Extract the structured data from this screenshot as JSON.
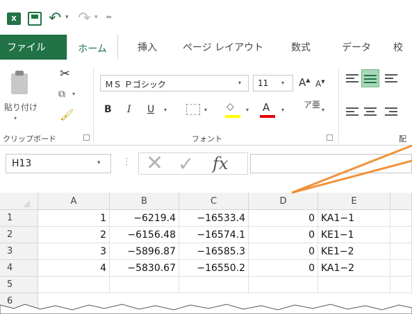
{
  "qat": {
    "excel_logo": "X",
    "undo_drop": "▾",
    "redo_drop": "▾",
    "more": "="
  },
  "tabs": {
    "file": "ファイル",
    "home": "ホーム",
    "insert": "挿入",
    "page_layout": "ページ レイアウト",
    "formulas": "数式",
    "data": "データ",
    "review": "校"
  },
  "ribbon": {
    "clipboard": {
      "paste_label": "貼り付け",
      "group_label": "クリップボード"
    },
    "font": {
      "font_name": "ＭＳ Ｐゴシック",
      "font_size": "11",
      "bold": "B",
      "italic": "I",
      "underline": "U",
      "fill_glyph": "◇",
      "font_color_glyph": "A",
      "phonetic_glyph": "ア亜",
      "group_label": "フォント"
    },
    "alignment": {
      "group_label": "配"
    }
  },
  "formula_bar": {
    "name_box": "H13",
    "dots": "⋮",
    "cancel": "✕",
    "enter": "✓",
    "fx": "fx",
    "formula": ""
  },
  "grid": {
    "columns": [
      "A",
      "B",
      "C",
      "D",
      "E"
    ],
    "rows": [
      "1",
      "2",
      "3",
      "4",
      "5",
      "6"
    ],
    "cells": [
      [
        "1",
        "−6219.4",
        "−16533.4",
        "0",
        "KA1−1"
      ],
      [
        "2",
        "−6156.48",
        "−16574.1",
        "0",
        "KE1−1"
      ],
      [
        "3",
        "−5896.87",
        "−16585.3",
        "0",
        "KE1−2"
      ],
      [
        "4",
        "−5830.67",
        "−16550.2",
        "0",
        "KA1−2"
      ],
      [
        "",
        "",
        "",
        "",
        ""
      ]
    ]
  },
  "colors": {
    "accent": "#217346",
    "callout": "#f0923a",
    "font_color_bar": "#e60000",
    "fill_color_bar": "#ffff00"
  }
}
